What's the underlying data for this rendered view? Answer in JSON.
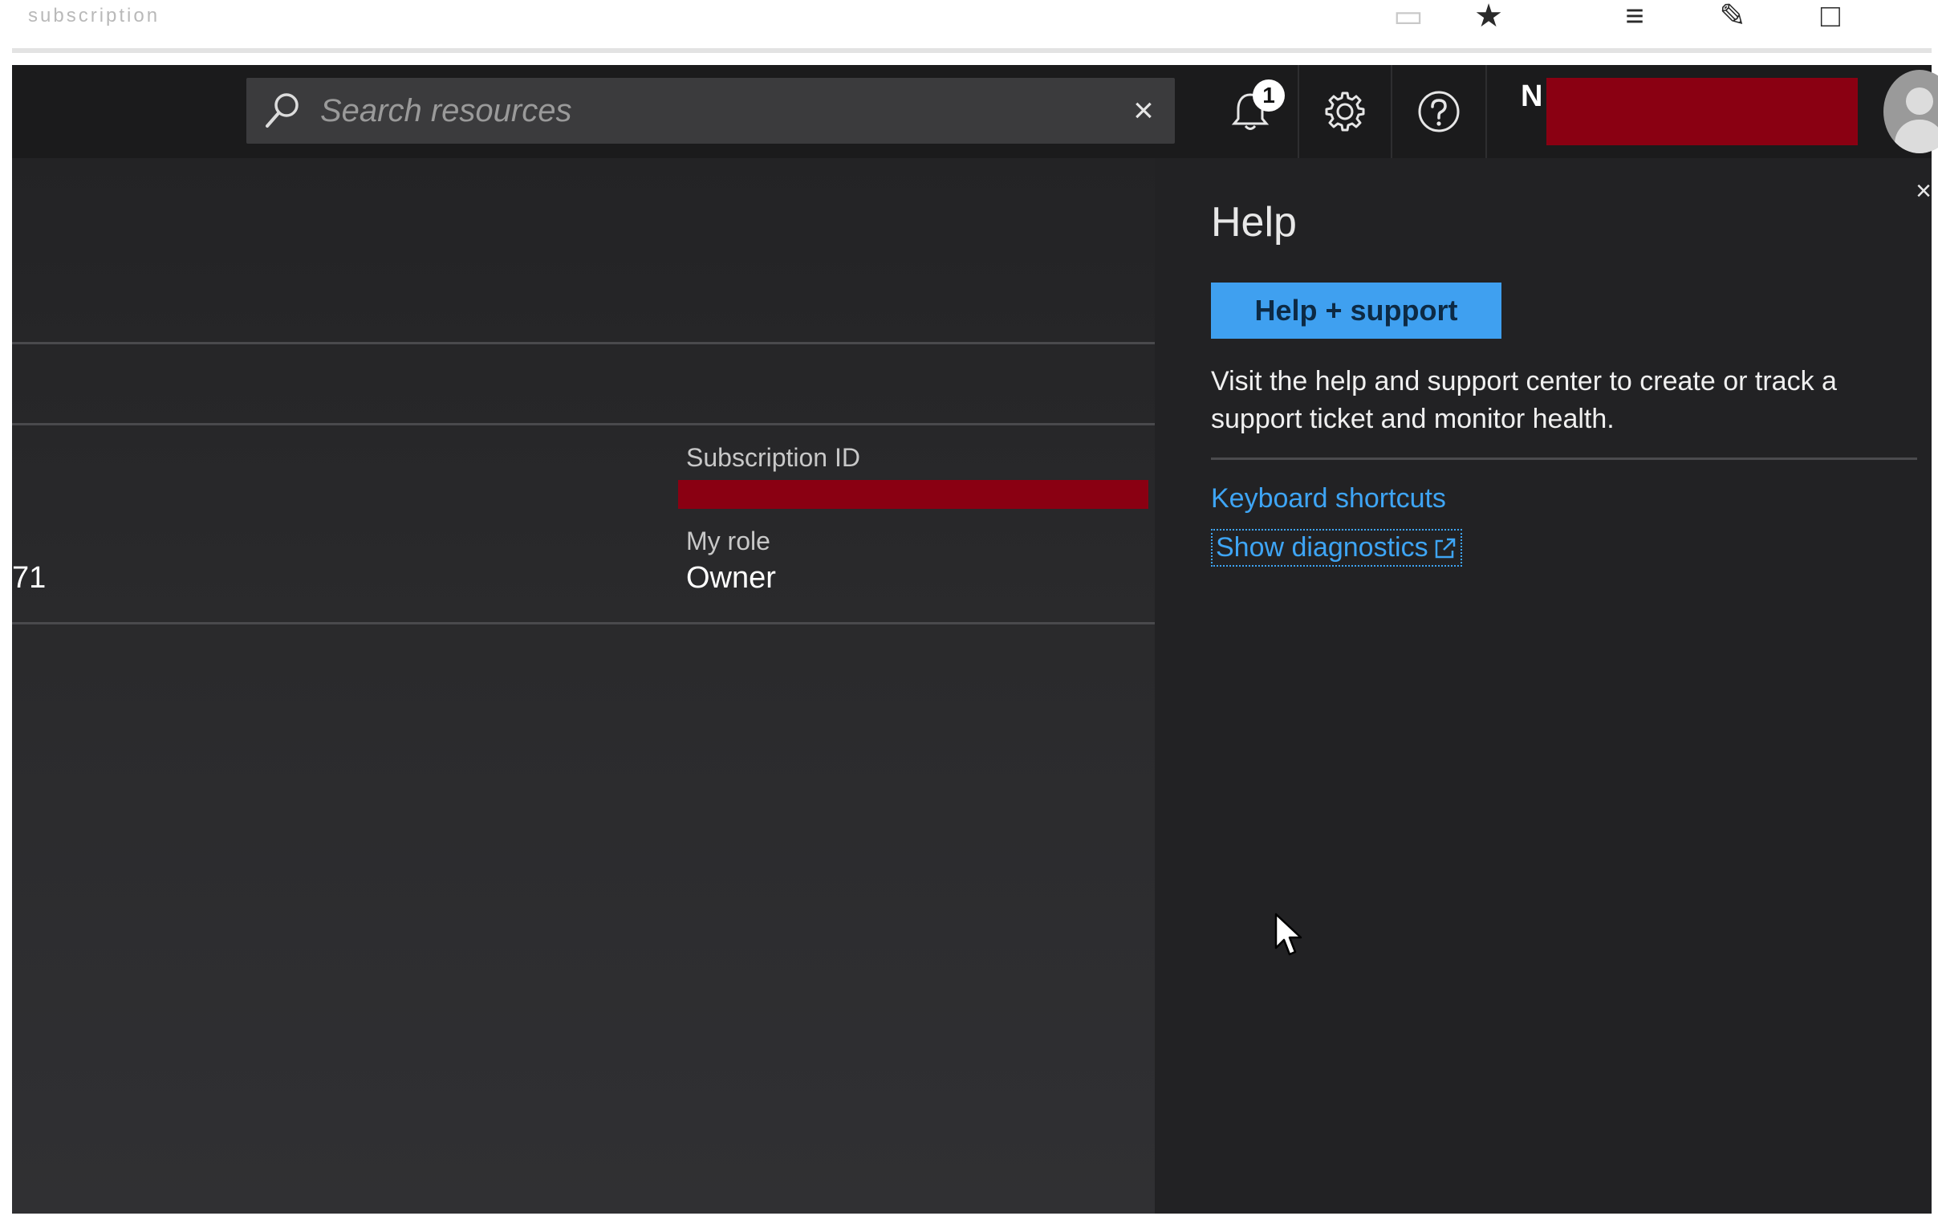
{
  "browser": {
    "address_text": "subscription",
    "icons": [
      "reading-view-icon",
      "favorite-star-icon",
      "favorites-hub-icon",
      "web-note-icon",
      "share-icon"
    ]
  },
  "topbar": {
    "search": {
      "placeholder": "Search resources",
      "value": ""
    },
    "clear_icon": "×",
    "notifications": {
      "icon": "bell-icon",
      "count": "1"
    },
    "settings_icon": "gear-icon",
    "help_icon": "question-circle-icon",
    "account": {
      "initial": "N",
      "name": "[redacted]"
    }
  },
  "main": {
    "subscription_id": {
      "label": "Subscription ID",
      "value": "[redacted]"
    },
    "my_role": {
      "label": "My role",
      "value": "Owner"
    },
    "left_fragment": "71"
  },
  "help_panel": {
    "title": "Help",
    "close_icon": "×",
    "primary_button": "Help + support",
    "description": "Visit the help and support center to create or track a support ticket and monitor health.",
    "links": [
      {
        "label": "Keyboard shortcuts"
      },
      {
        "label": "Show diagnostics",
        "icon": "external-link-icon"
      }
    ]
  },
  "colors": {
    "topbar_bg": "#1b1b1c",
    "panel_bg": "#222224",
    "accent_blue": "#3fa0f0",
    "link_blue": "#3ea5f5",
    "redaction": "#8a0012"
  }
}
